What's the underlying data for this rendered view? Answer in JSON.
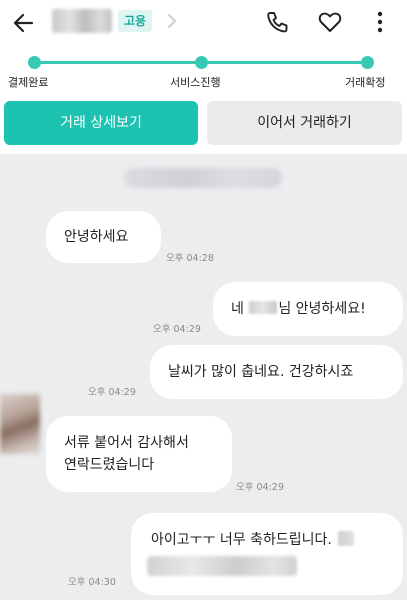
{
  "header": {
    "tag": "고용",
    "icons": [
      "back-arrow-icon",
      "chevron-right-icon",
      "phone-icon",
      "heart-icon",
      "more-vertical-icon"
    ]
  },
  "progress": {
    "steps": [
      "결제완료",
      "서비스진행",
      "거래확정"
    ],
    "color": "#36c9b6"
  },
  "actions": {
    "primary_label": "거래 상세보기",
    "secondary_label": "이어서 거래하기",
    "primary_color": "#1cc3b0"
  },
  "messages": [
    {
      "side": "left",
      "text": "안녕하세요",
      "time": "오후 04:28"
    },
    {
      "side": "right",
      "text_before": "네",
      "text_after": "님 안녕하세요!",
      "time": "오후 04:29"
    },
    {
      "side": "right",
      "text": "날씨가 많이 춥네요. 건강하시죠",
      "time": "오후 04:29"
    },
    {
      "side": "left",
      "line1": "서류 붙어서 감사해서",
      "line2": "연락드렸습니다",
      "time": "오후 04:29"
    },
    {
      "side": "right",
      "text": "아이고ㅜㅜ 너무 축하드립니다.",
      "time": "오후 04:30"
    }
  ]
}
